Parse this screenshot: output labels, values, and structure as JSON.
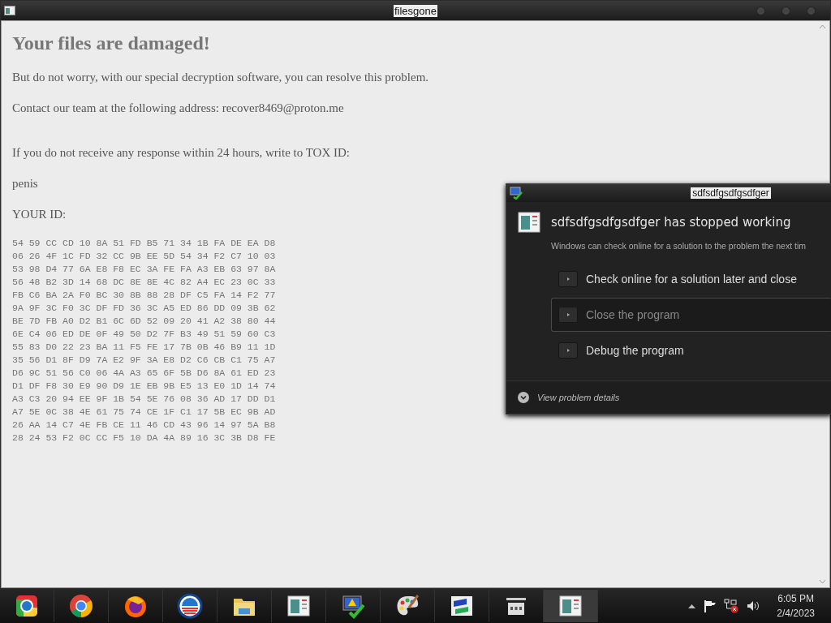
{
  "window": {
    "title": "filesgone"
  },
  "note": {
    "heading": "Your files are damaged!",
    "paragraphs": [
      "But do not worry, with our special decryption software, you can resolve this problem.",
      "Contact our team at the following address: recover8469@proton.me",
      "If you do not receive any response within 24 hours, write to TOX ID:",
      "penis",
      "YOUR ID:"
    ],
    "id_lines": [
      "54 59 CC CD 10 8A 51 FD B5 71 34 1B FA DE EA D8",
      "06 26 4F 1C FD 32 CC 9B EE 5D 54 34 F2 C7 10 03",
      "53 98 D4 77 6A E8 F8 EC 3A FE FA A3 EB 63 97 8A",
      "56 48 B2 3D 14 68 DC 8E 8E 4C 82 A4 EC 23 0C 33",
      "FB C6 BA 2A F0 BC 30 8B 88 28 DF C5 FA 14 F2 77",
      "9A 9F 3C F0 3C DF FD 36 3C A5 ED 86 DD 09 3B 62",
      "BE 7D FB A0 D2 B1 6C 6D 52 09 20 41 A2 38 80 44",
      "6E C4 06 ED DE 0F 49 50 D2 7F B3 49 51 59 60 C3",
      "55 83 D0 22 23 BA 11 F5 FE 17 7B 0B 46 B9 11 1D",
      "35 56 D1 8F D9 7A E2 9F 3A E8 D2 C6 CB C1 75 A7",
      "D6 9C 51 56 C0 06 4A A3 65 6F 5B D6 8A 61 ED 23",
      "D1 DF F8 30 E9 90 D9 1E EB 9B E5 13 E0 1D 14 74",
      "A3 C3 20 94 EE 9F 1B 54 5E 76 08 36 AD 17 DD D1",
      "A7 5E 0C 38 4E 61 75 74 CE 1F C1 17 5B EC 9B AD",
      "26 AA 14 C7 4E FB CE 11 46 CD 43 96 14 97 5A B8",
      "28 24 53 F2 0C CC F5 10 DA 4A 89 16 3C 3B D8 FE"
    ]
  },
  "dialog": {
    "title": "sdfsdfgsdfgsdfger",
    "heading": "sdfsdfgsdfgsdfger has stopped working",
    "message": "Windows can check online for a solution to the problem the next tim",
    "options": [
      {
        "label": "Check online for a solution later and close",
        "selected": false
      },
      {
        "label": "Close the program",
        "selected": true
      },
      {
        "label": "Debug the program",
        "selected": false
      }
    ],
    "details": "View problem details"
  },
  "taskbar": {
    "items": [
      {
        "kind": "ring-browser",
        "selected": false
      },
      {
        "kind": "round-browser",
        "selected": false
      },
      {
        "kind": "fox-browser",
        "selected": false
      },
      {
        "kind": "striped-circle",
        "selected": false
      },
      {
        "kind": "folder",
        "selected": false
      },
      {
        "kind": "app-window",
        "selected": false
      },
      {
        "kind": "monitor-check",
        "selected": false
      },
      {
        "kind": "palette",
        "selected": false
      },
      {
        "kind": "network-cards",
        "selected": false
      },
      {
        "kind": "register",
        "selected": false
      },
      {
        "kind": "app-window",
        "selected": true
      }
    ],
    "time": "6:05 PM",
    "date": "2/4/2023"
  }
}
